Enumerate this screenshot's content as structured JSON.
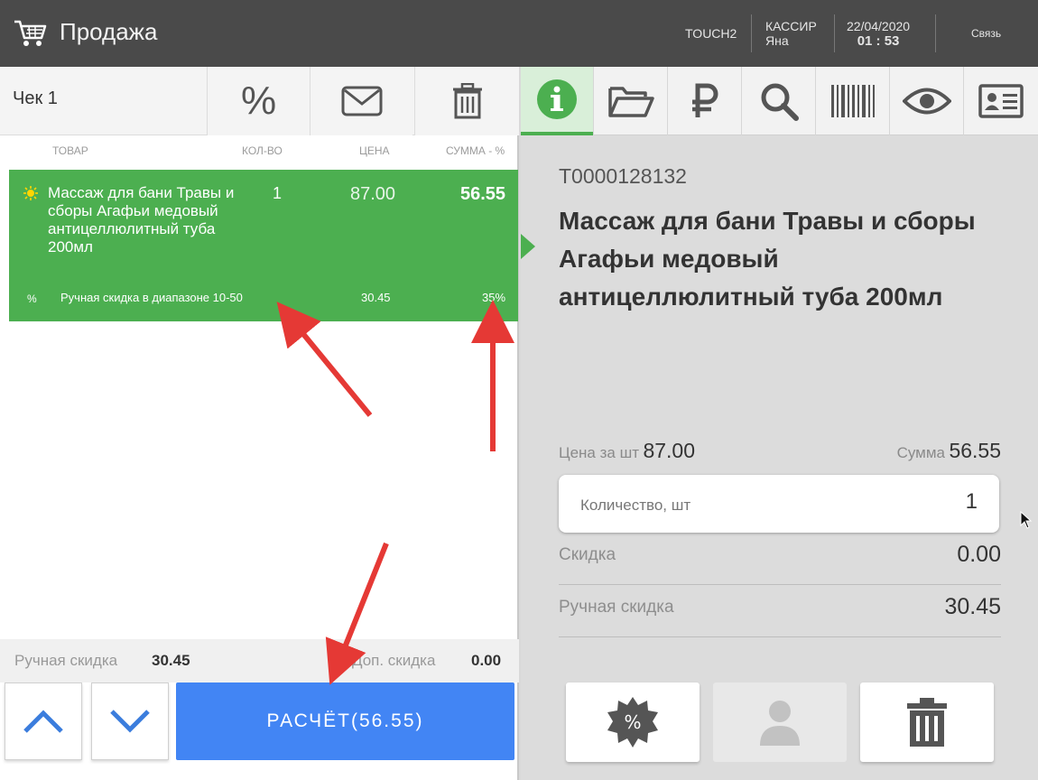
{
  "header": {
    "title": "Продажа",
    "terminal": "TOUCH2",
    "cashier_label": "КАССИР",
    "cashier_name": "Яна",
    "date": "22/04/2020",
    "time": "01 : 53",
    "link": "Связь"
  },
  "left_toolbar": {
    "check_title": "Чек 1",
    "percent_label": "%"
  },
  "columns": {
    "item": "ТОВАР",
    "qty": "КОЛ-ВО",
    "price": "ЦЕНА",
    "sum": "СУММА - %"
  },
  "row": {
    "name": "Массаж для бани Травы и сборы Агафьи медовый антицеллюлитный туба 200мл",
    "qty": "1",
    "price": "87.00",
    "sum": "56.55",
    "discount_mark": "%",
    "discount_name": "Ручная скидка в диапазоне 10-50",
    "discount_value": "30.45",
    "discount_percent": "35%"
  },
  "summary": {
    "manual_label": "Ручная скидка",
    "manual_value": "30.45",
    "extra_label": "Доп. скидка",
    "extra_value": "0.00"
  },
  "pay_button": "РАСЧЁТ(56.55)",
  "detail": {
    "code": "Т0000128132",
    "name": "Массаж для бани Травы и сборы Агафьи медовый антицеллюлитный туба 200мл",
    "price_label": "Цена за шт",
    "price_value": "87.00",
    "sum_label": "Сумма",
    "sum_value": "56.55",
    "qty_placeholder": "Количество, шт",
    "qty_value": "1",
    "discount_label": "Скидка",
    "discount_value": "0.00",
    "manual_label": "Ручная скидка",
    "manual_value": "30.45",
    "act_percent_label": "%"
  },
  "colors": {
    "accent_green": "#4caf50",
    "pay_blue": "#4285f4",
    "header_bg": "#4a4a4a",
    "annotation_red": "#e53935"
  },
  "icons": [
    "cart-icon",
    "percent-icon",
    "mail-icon",
    "trash-icon",
    "info-icon",
    "folder-icon",
    "ruble-icon",
    "search-icon",
    "barcode-icon",
    "eye-icon",
    "id-card-icon",
    "chevron-up-icon",
    "chevron-down-icon",
    "discount-badge-icon",
    "user-icon"
  ]
}
